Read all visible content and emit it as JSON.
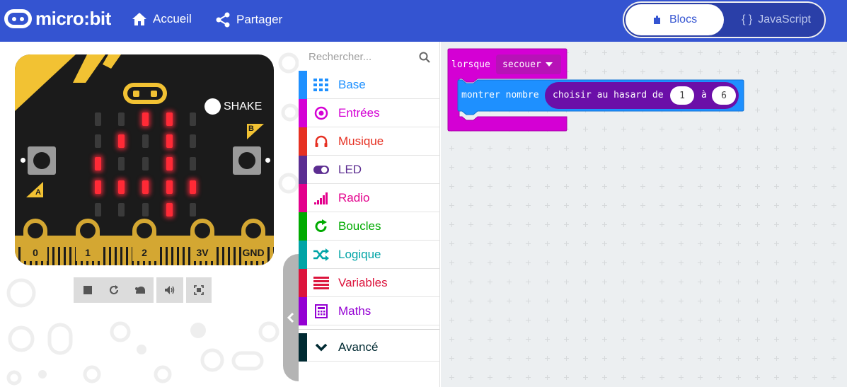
{
  "header": {
    "brand": "micro:bit",
    "nav": {
      "home_label": "Accueil",
      "share_label": "Partager"
    },
    "editor_toggle": {
      "blocks_label": "Blocs",
      "javascript_label": "JavaScript",
      "js_glyph": "{ }",
      "active": "Blocs"
    }
  },
  "simulator": {
    "shake_label": "SHAKE",
    "button_a_label": "A",
    "button_b_label": "B",
    "pins": [
      "0",
      "1",
      "2",
      "3V",
      "GND"
    ],
    "led_matrix": [
      [
        0,
        0,
        1,
        1,
        0
      ],
      [
        0,
        1,
        0,
        1,
        0
      ],
      [
        1,
        0,
        0,
        1,
        0
      ],
      [
        1,
        1,
        1,
        1,
        1
      ],
      [
        0,
        0,
        0,
        1,
        0
      ]
    ],
    "toolbar": [
      "stop-icon",
      "restart-icon",
      "slow-motion-icon",
      "sound-icon",
      "screenshot-icon"
    ]
  },
  "toolbox": {
    "search_placeholder": "Rechercher...",
    "categories": [
      {
        "label": "Base",
        "color": "#1e90ff",
        "icon": "grid-icon"
      },
      {
        "label": "Entrées",
        "color": "#d400d4",
        "icon": "target-icon"
      },
      {
        "label": "Musique",
        "color": "#e63022",
        "icon": "headphones-icon"
      },
      {
        "label": "LED",
        "color": "#5c2d91",
        "icon": "toggle-icon"
      },
      {
        "label": "Radio",
        "color": "#e3008c",
        "icon": "signal-icon"
      },
      {
        "label": "Boucles",
        "color": "#00aa00",
        "icon": "refresh-icon"
      },
      {
        "label": "Logique",
        "color": "#00a4a6",
        "icon": "shuffle-icon"
      },
      {
        "label": "Variables",
        "color": "#dc143c",
        "icon": "lines-icon"
      },
      {
        "label": "Maths",
        "color": "#9400d3",
        "icon": "calculator-icon"
      }
    ],
    "advanced": {
      "label": "Avancé",
      "color": "#002a32",
      "icon": "chevron-down-icon"
    }
  },
  "workspace": {
    "event_block": {
      "keyword": "lorsque",
      "dropdown_value": "secouer",
      "color": "#d400d4"
    },
    "show_number_block": {
      "label": "montrer nombre",
      "color": "#1e90ff"
    },
    "random_block": {
      "label": "choisir au hasard de",
      "from": "1",
      "to_word": "à",
      "to": "6",
      "color": "#6b0fa8"
    }
  }
}
